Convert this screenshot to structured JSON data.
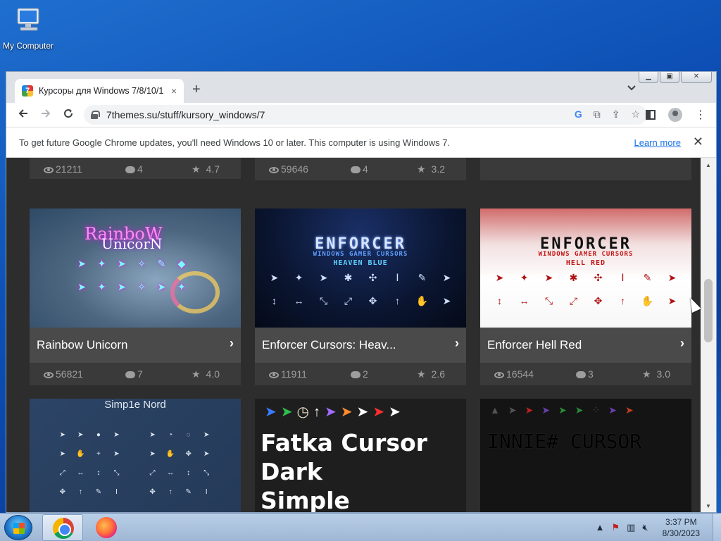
{
  "desktop": {
    "icon_label": "My Computer"
  },
  "browser": {
    "tab_title": "Курсоры для Windows 7/8/10/1",
    "tab_favicon_text": "7",
    "new_tab": "+",
    "tab_close": "×",
    "tab_menu": "⌄",
    "url": "7themes.su/stuff/kursory_windows/7",
    "infobar": {
      "message": "To get future Google Chrome updates, you'll need Windows 10 or later. This computer is using Windows 7.",
      "learn_more": "Learn more",
      "close": "✕"
    }
  },
  "page": {
    "top_row_stats": [
      {
        "views": "21211",
        "comments": "4",
        "rating": "4.7"
      },
      {
        "views": "59646",
        "comments": "4",
        "rating": "3.2"
      }
    ],
    "cards": [
      {
        "title": "Rainbow Unicorn",
        "views": "56821",
        "comments": "7",
        "rating": "4.0",
        "thumb_text_1": "RainboW",
        "thumb_text_2": "UnicorN"
      },
      {
        "title": "Enforcer Cursors: Heav...",
        "views": "11911",
        "comments": "2",
        "rating": "2.6",
        "thumb_title": "ENFORCER",
        "thumb_sub": "WINDOWS GAMER CURSORS",
        "thumb_variant": "HEAVEN BLUE"
      },
      {
        "title": "Enforcer Hell Red",
        "views": "16544",
        "comments": "3",
        "rating": "3.0",
        "thumb_title": "ENFORCER",
        "thumb_sub": "WINDOWS GAMER CURSORS",
        "thumb_variant": "HELL RED"
      }
    ],
    "bottom_cards": [
      {
        "thumb_title": "Simp1e Nord"
      },
      {
        "thumb_lines": [
          "Fatka Cursor",
          "Dark",
          "Simple"
        ]
      },
      {
        "thumb_title": "INNIE# CURSOR"
      }
    ]
  },
  "taskbar": {
    "time": "3:37 PM",
    "date": "8/30/2023",
    "apps": [
      "chrome",
      "firefox"
    ]
  },
  "colors": {
    "page_bg": "#2d2d2d",
    "card_title_bg": "#4a4a4a",
    "link": "#1a73e8"
  }
}
